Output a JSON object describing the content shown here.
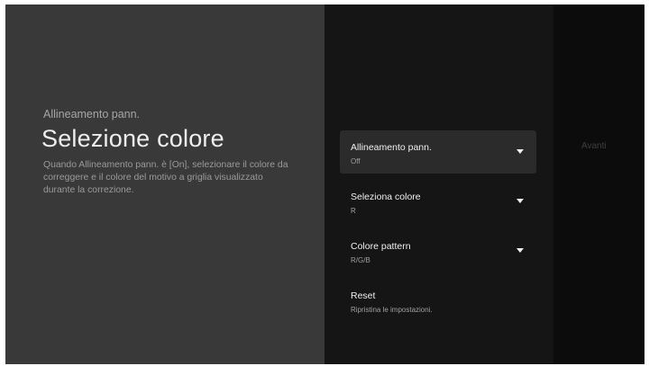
{
  "left_panel": {
    "breadcrumb": "Allineamento pann.",
    "title": "Selezione colore",
    "description": "Quando Allineamento pann. è [On], selezionare il colore da correggere e il colore del motivo a griglia visualizzato durante la correzione."
  },
  "menu": {
    "items": [
      {
        "label": "Allineamento pann.",
        "value": "Off",
        "icon": "chevron-down-icon"
      },
      {
        "label": "Seleziona colore",
        "value": "R",
        "icon": "chevron-down-icon"
      },
      {
        "label": "Colore pattern",
        "value": "R/G/B",
        "icon": "chevron-down-icon"
      },
      {
        "label": "Reset",
        "value": "Ripristina le impostazioni."
      }
    ]
  },
  "right_panel": {
    "next_label": "Avanti"
  }
}
